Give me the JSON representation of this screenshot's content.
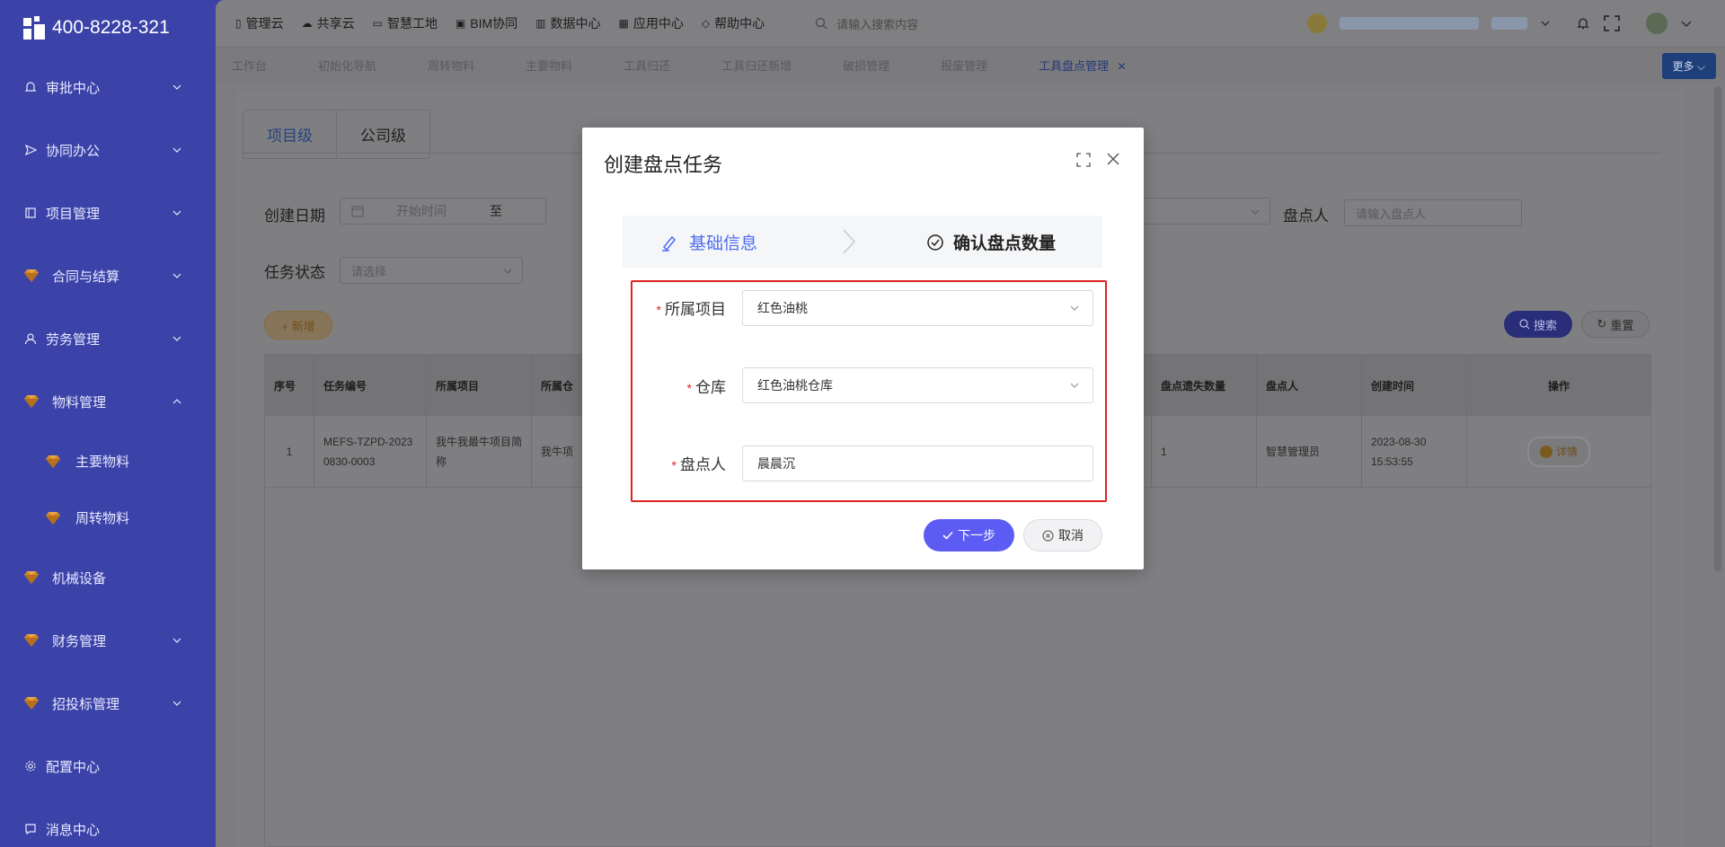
{
  "brand": {
    "phone": "400-8228-321"
  },
  "sidebar": {
    "items": [
      {
        "label": "审批中心",
        "icon": "bell-icon",
        "expandable": true
      },
      {
        "label": "协同办公",
        "icon": "send-icon",
        "expandable": true
      },
      {
        "label": "项目管理",
        "icon": "book-icon",
        "expandable": true
      },
      {
        "label": "合同与结算",
        "icon": "gem-icon",
        "expandable": true
      },
      {
        "label": "劳务管理",
        "icon": "user-icon",
        "expandable": true
      },
      {
        "label": "物料管理",
        "icon": "gem-icon",
        "expandable": true,
        "expanded": true
      },
      {
        "label": "机械设备",
        "icon": "gem-icon",
        "expandable": false
      },
      {
        "label": "财务管理",
        "icon": "gem-icon",
        "expandable": true
      },
      {
        "label": "招投标管理",
        "icon": "gem-icon",
        "expandable": true
      },
      {
        "label": "配置中心",
        "icon": "gear-icon",
        "expandable": false
      },
      {
        "label": "消息中心",
        "icon": "message-icon",
        "expandable": false
      }
    ],
    "subitems": [
      {
        "label": "主要物料",
        "icon": "gem-icon"
      },
      {
        "label": "周转物料",
        "icon": "gem-icon"
      }
    ]
  },
  "topbar": {
    "menus": [
      {
        "label": "管理云",
        "icon": "phone-icon"
      },
      {
        "label": "共享云",
        "icon": "cloud-icon"
      },
      {
        "label": "智慧工地",
        "icon": "tablet-icon"
      },
      {
        "label": "BIM协同",
        "icon": "cube-icon"
      },
      {
        "label": "数据中心",
        "icon": "bar-chart-icon"
      },
      {
        "label": "应用中心",
        "icon": "grid-icon"
      },
      {
        "label": "帮助中心",
        "icon": "diamond-icon"
      }
    ],
    "search_placeholder": "请输入搜索内容"
  },
  "tabs": {
    "items": [
      "工作台",
      "初始化导航",
      "周转物料",
      "主要物料",
      "工具归还",
      "工具归还新增",
      "破损管理",
      "报废管理",
      "工具盘点管理"
    ],
    "active": "工具盘点管理",
    "more_label": "更多"
  },
  "page": {
    "level_tabs": [
      "项目级",
      "公司级"
    ],
    "filters": {
      "create_date_label": "创建日期",
      "start_placeholder": "开始时间",
      "range_sep": "至",
      "counter_label": "盘点人",
      "counter_placeholder": "请输入盘点人",
      "status_label": "任务状态",
      "status_placeholder": "请选择"
    },
    "add_label": "+ 新增",
    "search_label": "搜索",
    "reset_label": "重置",
    "table": {
      "headers": [
        "序号",
        "任务编号",
        "所属项目",
        "所属仓",
        "盘点遗失数量",
        "盘点人",
        "创建时间",
        "操作"
      ],
      "rows": [
        {
          "index": "1",
          "code": "MEFS-TZPD-20230830-0003",
          "project": "我牛我最牛项目简称",
          "warehouse": "我牛项",
          "lost": "1",
          "counter": "智慧管理员",
          "created": "2023-08-30 15:53:55",
          "action": "详情"
        }
      ]
    }
  },
  "dialog": {
    "title": "创建盘点任务",
    "steps": [
      "基础信息",
      "确认盘点数量"
    ],
    "fields": [
      {
        "label": "所属项目",
        "value": "红色油桃",
        "type": "select",
        "required": true
      },
      {
        "label": "仓库",
        "value": "红色油桃仓库",
        "type": "select",
        "required": true
      },
      {
        "label": "盘点人",
        "value": "晨晨沉",
        "type": "text",
        "required": true
      }
    ],
    "next_label": "下一步",
    "cancel_label": "取消",
    "accent": "#5c5cf5",
    "highlight": "#e02121"
  }
}
